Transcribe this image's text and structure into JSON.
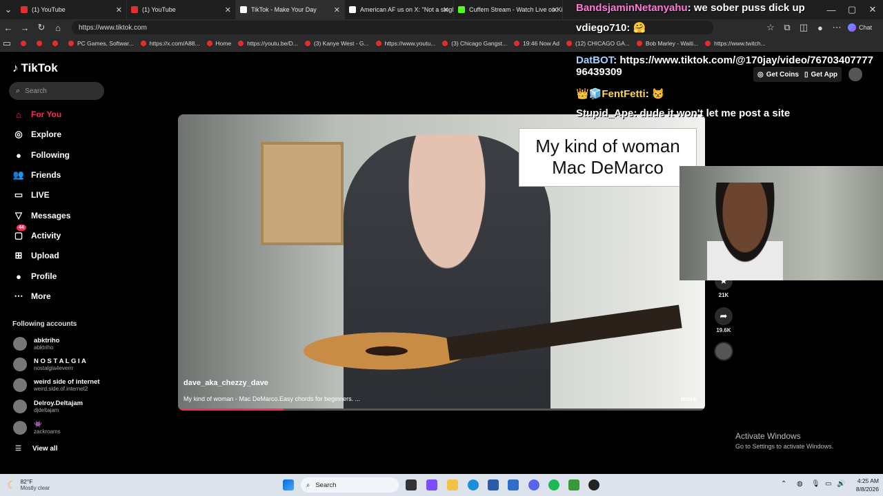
{
  "browser": {
    "tabs": [
      {
        "label": "(1) YouTube",
        "icon_color": "#e0302e",
        "active": false
      },
      {
        "label": "(1) YouTube",
        "icon_color": "#e0302e",
        "active": false
      },
      {
        "label": "TikTok - Make Your Day",
        "icon_color": "#ffffff",
        "active": true
      },
      {
        "label": "American AF us on X: \"Not a singl",
        "icon_color": "#ffffff",
        "active": false
      },
      {
        "label": "Cuffem Stream - Watch Live on Ki",
        "icon_color": "#53fc18",
        "active": false
      }
    ],
    "url": "https://www.tiktok.com",
    "copilot_label": "Chat",
    "bookmarks": [
      "",
      "",
      "",
      "PC Games, Softwar...",
      "https://x.com/A88...",
      "Home",
      "https://youtu.be/D...",
      "(3) Kanye West - G...",
      "https://www.youtu...",
      "(3) Chicago Gangst...",
      "19:46 Now Ad",
      "(12) CHICAGO GA...",
      "Bob Marley - Waiti...",
      "https://www.twitch..."
    ]
  },
  "tiktok": {
    "logo": "TikTok",
    "search_placeholder": "Search",
    "nav": [
      {
        "label": "For You",
        "icon": "home-icon",
        "glyph": "⌂",
        "active": true
      },
      {
        "label": "Explore",
        "icon": "compass-icon",
        "glyph": "◎",
        "active": false
      },
      {
        "label": "Following",
        "icon": "following-avatar-icon",
        "glyph": "●",
        "active": false
      },
      {
        "label": "Friends",
        "icon": "friends-icon",
        "glyph": "👥",
        "active": false
      },
      {
        "label": "LIVE",
        "icon": "live-icon",
        "glyph": "▭",
        "active": false
      },
      {
        "label": "Messages",
        "icon": "messages-icon",
        "glyph": "▽",
        "active": false
      },
      {
        "label": "Activity",
        "icon": "activity-icon",
        "glyph": "▢",
        "active": false,
        "badge": "44"
      },
      {
        "label": "Upload",
        "icon": "upload-icon",
        "glyph": "⊞",
        "active": false
      },
      {
        "label": "Profile",
        "icon": "profile-avatar-icon",
        "glyph": "●",
        "active": false
      },
      {
        "label": "More",
        "icon": "more-icon",
        "glyph": "⋯",
        "active": false
      }
    ],
    "following_header": "Following accounts",
    "following_accounts": [
      {
        "name": "abktriho",
        "handle": "abktriho"
      },
      {
        "name": "N O S T A L G I A",
        "handle": "nostalgia4everrr"
      },
      {
        "name": "weird side of internet",
        "handle": "weird.side.of.internet2"
      },
      {
        "name": "Delroy.Deltajam",
        "handle": "djdeltajam"
      },
      {
        "name": "👾",
        "handle": "zackroams"
      }
    ],
    "view_all": "View all",
    "get_coins": "Get Coins",
    "get_app": "Get App",
    "video": {
      "caption_line1": "My kind of woman",
      "caption_line2": "Mac DeMarco",
      "author": "dave_aka_chezzy_dave",
      "description": "My kind of woman - Mac DeMarco.Easy chords for beginners. ...",
      "more": "more",
      "progress": 0.2
    },
    "actions": [
      {
        "name": "bookmark",
        "count": "21K",
        "glyph": "★"
      },
      {
        "name": "share",
        "count": "19.6K",
        "glyph": "➦"
      }
    ]
  },
  "stream_overlay": {
    "chat": [
      {
        "user": "BandsjaminNetanyahu",
        "text": "we sober puss dick up",
        "color": "#ff7ad9"
      },
      {
        "user": "vdiego710",
        "text": "🤗",
        "color": "#ffffff"
      },
      {
        "user": "DatBOT",
        "text": "https://www.tiktok.com/@170jay/video/7670340777796439309",
        "color": "#9fd2ff"
      },
      {
        "user": "👑🧊FentFetti",
        "text": "😾",
        "color": "#ffd84a"
      },
      {
        "user": "Stupid_Ape",
        "text": "dude it won't let me post a site",
        "color": "#ffffff"
      }
    ]
  },
  "windows_watermark": {
    "title": "Activate Windows",
    "subtitle": "Go to Settings to activate Windows."
  },
  "taskbar": {
    "weather_temp": "82°F",
    "weather_desc": "Mostly clear",
    "search_label": "Search",
    "time": "4:25 AM",
    "date": "8/8/2026"
  }
}
